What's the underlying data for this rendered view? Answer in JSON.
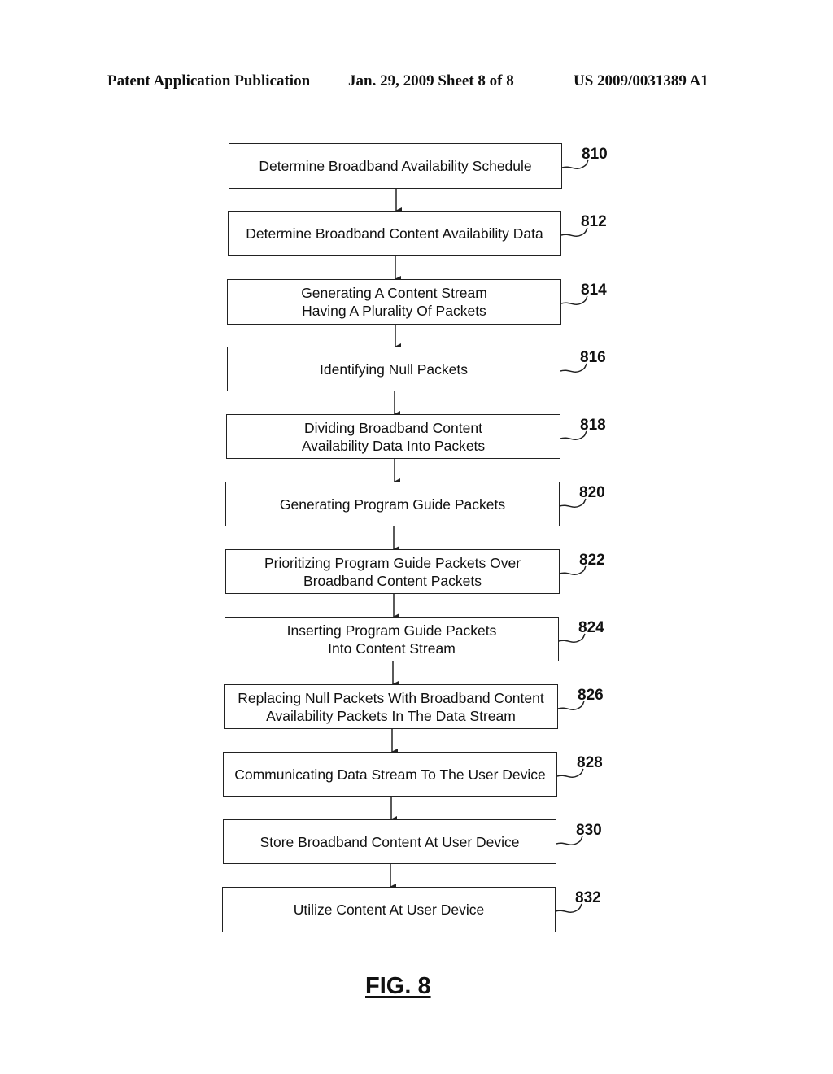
{
  "header": {
    "publication": "Patent Application Publication",
    "date_sheet": "Jan. 29, 2009  Sheet 8 of 8",
    "patent_number": "US 2009/0031389 A1"
  },
  "flowchart": {
    "steps": [
      {
        "ref": "810",
        "text": "Determine Broadband Availability Schedule"
      },
      {
        "ref": "812",
        "text": "Determine Broadband Content Availability Data"
      },
      {
        "ref": "814",
        "text": "Generating A Content Stream\nHaving A Plurality Of Packets"
      },
      {
        "ref": "816",
        "text": "Identifying Null Packets"
      },
      {
        "ref": "818",
        "text": "Dividing Broadband Content\nAvailability Data Into Packets"
      },
      {
        "ref": "820",
        "text": "Generating Program Guide Packets"
      },
      {
        "ref": "822",
        "text": "Prioritizing Program Guide Packets Over\nBroadband Content Packets"
      },
      {
        "ref": "824",
        "text": "Inserting Program Guide Packets\nInto Content Stream"
      },
      {
        "ref": "826",
        "text": "Replacing Null Packets With Broadband Content\nAvailability Packets In The Data Stream"
      },
      {
        "ref": "828",
        "text": "Communicating Data Stream To The User Device"
      },
      {
        "ref": "830",
        "text": "Store Broadband Content At User Device"
      },
      {
        "ref": "832",
        "text": "Utilize Content At User Device"
      }
    ]
  },
  "figure_label": "FIG. 8"
}
